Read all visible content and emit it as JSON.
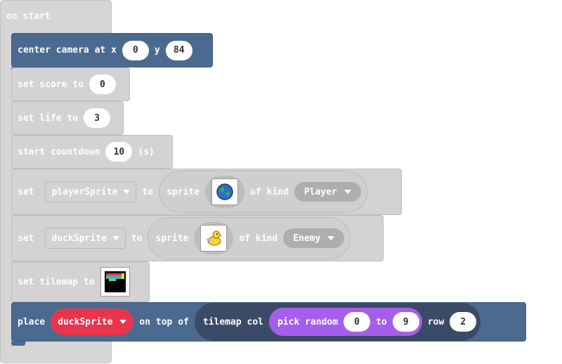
{
  "on_start": {
    "label": "on start"
  },
  "camera": {
    "label": "center camera at x",
    "x": "0",
    "y_label": "y",
    "y": "84"
  },
  "set_score": {
    "label": "set score to",
    "value": "0"
  },
  "set_life": {
    "label": "set life to",
    "value": "3"
  },
  "countdown": {
    "label": "start countdown",
    "value": "10",
    "unit": "(s)"
  },
  "player_block": {
    "set": "set",
    "variable": "playerSprite",
    "to": "to",
    "sprite": "sprite",
    "of_kind": "of kind",
    "kind": "Player",
    "image_icon": "earth-sprite"
  },
  "duck_block": {
    "set": "set",
    "variable": "duckSprite",
    "to": "to",
    "sprite": "sprite",
    "of_kind": "of kind",
    "kind": "Enemy",
    "image_icon": "duck-sprite"
  },
  "tilemap_block": {
    "label": "set tilemap to",
    "image_icon": "tilemap-thumbnail"
  },
  "place_block": {
    "place": "place",
    "variable": "duckSprite",
    "on_top_of": "on top of",
    "tilemap_col": "tilemap col",
    "pick_random": "pick random",
    "from": "0",
    "to": "to",
    "to_value": "9",
    "row": "row",
    "row_value": "2"
  },
  "colors": {
    "hat": "#d6d6d6",
    "sprites_blue": "#4b6a8f",
    "variables_red": "#e8354e",
    "math_purple": "#a55eea",
    "scene_navy": "#3b4a66"
  }
}
